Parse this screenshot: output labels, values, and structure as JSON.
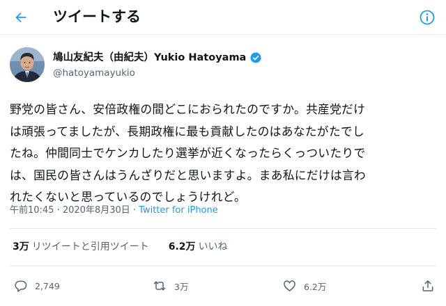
{
  "header": {
    "title": "ツイートする"
  },
  "author": {
    "name": "鳩山友紀夫（由紀夫）Yukio Hatoyama",
    "handle": "@hatoyamayukio"
  },
  "tweet": {
    "lines": [
      "野党の皆さん、安倍政権の間どこにおられたのですか。共産党だけ",
      "は頑張ってましたが、長期政権に最も貢献したのはあなたがたでし",
      "たね。仲間同士でケンカしたり選挙が近くなったらくっついたりで",
      "は、国民の皆さんはうんざりだと思いますよ。まあ私にだけは言わ",
      "れたくないと思っているのでしょうけれど。"
    ],
    "timestamp": "午前10:45 · 2020年8月30日 · ",
    "source": "Twitter for iPhone"
  },
  "stats": {
    "retweets_count": "3万",
    "retweets_label": "リツイートと引用ツイート",
    "likes_count": "6.2万",
    "likes_label": "いいね"
  },
  "actions": {
    "reply_count": "2,749",
    "retweet_count": "3万",
    "like_count": "6.2万"
  },
  "colors": {
    "accent": "#1d9bf0",
    "secondary_text": "#536471",
    "divider": "#e1e8ed"
  }
}
